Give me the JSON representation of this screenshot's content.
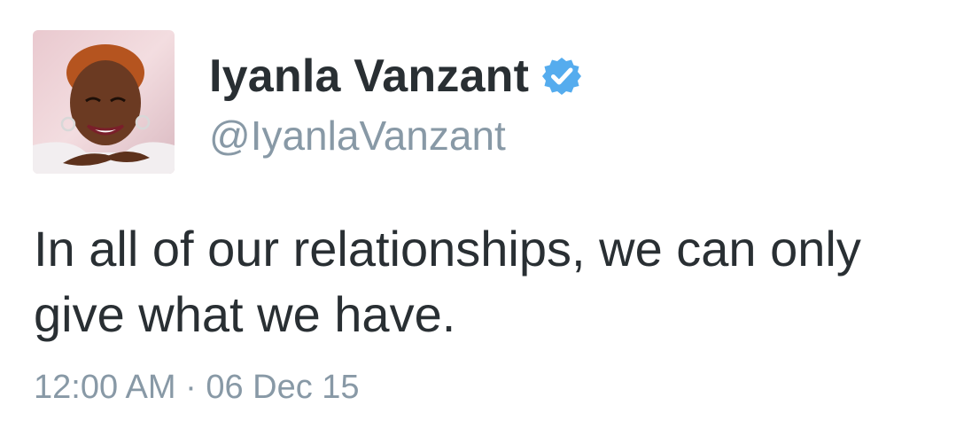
{
  "tweet": {
    "author": {
      "display_name": "Iyanla Vanzant",
      "handle": "@IyanlaVanzant",
      "verified": true,
      "avatar_icon": "profile-photo"
    },
    "text": "In all of our relationships, we can only give what we have.",
    "timestamp": "12:00 AM · 06 Dec 15"
  },
  "colors": {
    "text": "#292f33",
    "secondary": "#8899a6",
    "verified_badge": "#55acee"
  }
}
